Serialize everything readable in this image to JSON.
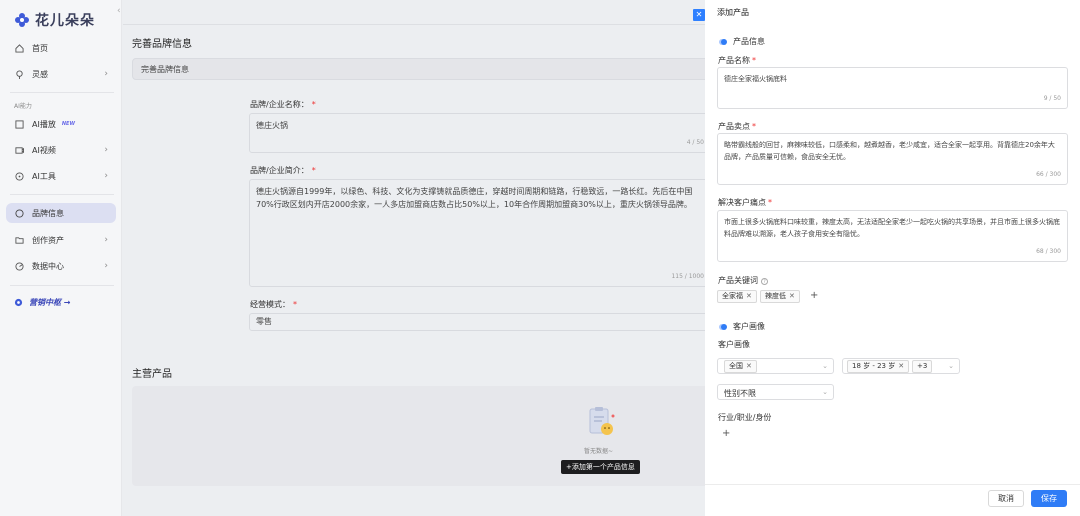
{
  "app": {
    "name": "花儿朵朵"
  },
  "sidebar": {
    "items": [
      {
        "label": "首页",
        "icon": "home-icon"
      },
      {
        "label": "灵感",
        "icon": "lightbulb-icon"
      },
      {
        "label": "AI播放",
        "badge": "NEW",
        "icon": "ai-play-icon"
      },
      {
        "label": "AI视频",
        "icon": "video-icon"
      },
      {
        "label": "AI工具",
        "icon": "tool-icon"
      },
      {
        "label": "品牌信息",
        "icon": "brand-icon"
      },
      {
        "label": "创作资产",
        "icon": "folder-icon"
      },
      {
        "label": "数据中心",
        "icon": "data-icon"
      }
    ],
    "section_label": "AI能力",
    "promo": "营销中枢 →"
  },
  "main": {
    "title": "完善品牌信息",
    "card_header": "完善品牌信息",
    "brand_name_label": "品牌/企业名称：",
    "brand_name_value": "德庄火锅",
    "brand_name_count": "4 / 50",
    "brand_intro_label": "品牌/企业简介：",
    "brand_intro_value": "德庄火锅源自1999年，以绿色、科技、文化为支撑铸就品质德庄，穿越时间周期和链路，行稳致远，一路长红。先后在中国70%行政区划内开店2000余家，一人多店加盟商店数占比50%以上，10年合作周期加盟商30%以上，重庆火锅领导品牌。",
    "brand_intro_count": "115 / 1000",
    "mode_label": "经营模式：",
    "mode_value": "零售",
    "products_title": "主营产品",
    "empty_text": "暂无数据~",
    "empty_button": "+添加第一个产品信息"
  },
  "drawer": {
    "title": "添加产品",
    "section_product": "产品信息",
    "name_label": "产品名称",
    "name_value": "德庄全家福火锅底料",
    "name_count": "9 / 50",
    "selling_label": "产品卖点",
    "selling_value": "略带霸线般的回甘，麻辣味较低，口感柔和，越煮越香，老少咸宜，适合全家一起享用。背靠德庄20余年大品牌，产品质量可信赖，食品安全无忧。",
    "selling_count": "66 / 300",
    "pain_label": "解决客户痛点",
    "pain_value": "市面上很多火锅底料口味较重，辣度太高，无法适配全家老少一起吃火锅的共享场景，并且市面上很多火锅底料品牌难以溯源，老人孩子食用安全有隐忧。",
    "pain_count": "68 / 300",
    "keywords_label": "产品关键词",
    "keywords": [
      "全家福",
      "辣度低"
    ],
    "section_customer": "客户画像",
    "customer_label": "客户画像",
    "region_tag": "全国",
    "age_tag": "18 岁 - 23 岁",
    "age_more": "+3",
    "gender_value": "性别不限",
    "industry_label": "行业/职业/身份",
    "cancel": "取消",
    "save": "保存"
  },
  "colors": {
    "primary": "#2f7cf6",
    "sidebar_active": "#dcdff2",
    "brand_text": "#3a3f5c"
  }
}
